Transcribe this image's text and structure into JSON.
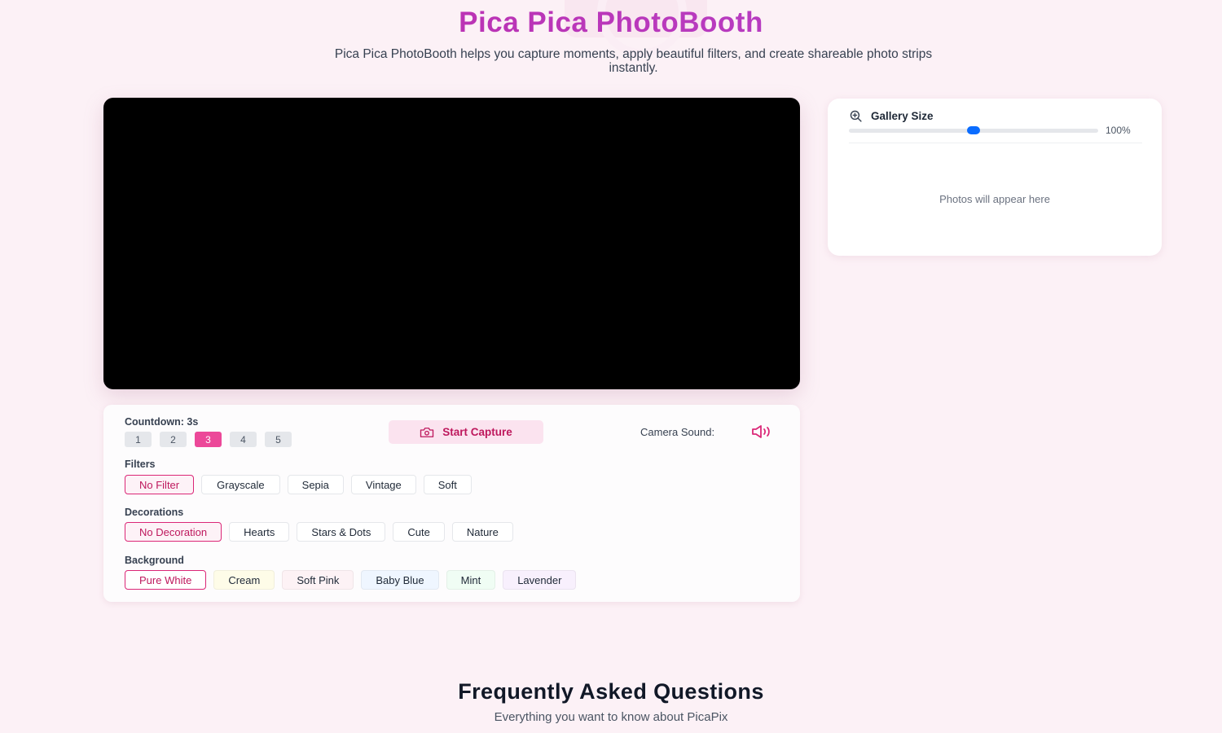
{
  "header": {
    "title": "Pica Pica PhotoBooth",
    "subtitle": "Pica Pica PhotoBooth helps you capture moments, apply beautiful filters, and create shareable photo strips instantly."
  },
  "gallery": {
    "title": "Gallery Size",
    "icon": "zoom-in-icon",
    "slider_value_label": "100%",
    "slider_fraction": 0.5,
    "slider_color": "#0a6cff",
    "empty_text": "Photos will appear here"
  },
  "controls": {
    "countdown_label": "Countdown: 3s",
    "countdown_options": [
      "1",
      "2",
      "3",
      "4",
      "5"
    ],
    "countdown_selected": "3",
    "start_capture_label": "Start Capture",
    "start_capture_icon": "camera-icon",
    "camera_sound_label": "Camera Sound:",
    "camera_sound_icon": "speaker-on-icon",
    "filters_label": "Filters",
    "filters": [
      {
        "label": "No Filter",
        "selected": true
      },
      {
        "label": "Grayscale",
        "selected": false
      },
      {
        "label": "Sepia",
        "selected": false
      },
      {
        "label": "Vintage",
        "selected": false
      },
      {
        "label": "Soft",
        "selected": false
      }
    ],
    "decorations_label": "Decorations",
    "decorations": [
      {
        "label": "No Decoration",
        "selected": true
      },
      {
        "label": "Hearts",
        "selected": false
      },
      {
        "label": "Stars & Dots",
        "selected": false
      },
      {
        "label": "Cute",
        "selected": false
      },
      {
        "label": "Nature",
        "selected": false
      }
    ],
    "background_label": "Background",
    "backgrounds": [
      {
        "label": "Pure White",
        "color": "#ffffff",
        "selected": true
      },
      {
        "label": "Cream",
        "color": "#fefce8",
        "selected": false
      },
      {
        "label": "Soft Pink",
        "color": "#fdf2f5",
        "selected": false
      },
      {
        "label": "Baby Blue",
        "color": "#eff6ff",
        "selected": false
      },
      {
        "label": "Mint",
        "color": "#f0fdf4",
        "selected": false
      },
      {
        "label": "Lavender",
        "color": "#f8f0fd",
        "selected": false
      }
    ]
  },
  "faq": {
    "title": "Frequently Asked Questions",
    "subtitle": "Everything you want to know about PicaPix"
  },
  "colors": {
    "accent": "#ec4899",
    "accent_text": "#be185d",
    "page_bg": "#fcf1f6"
  }
}
